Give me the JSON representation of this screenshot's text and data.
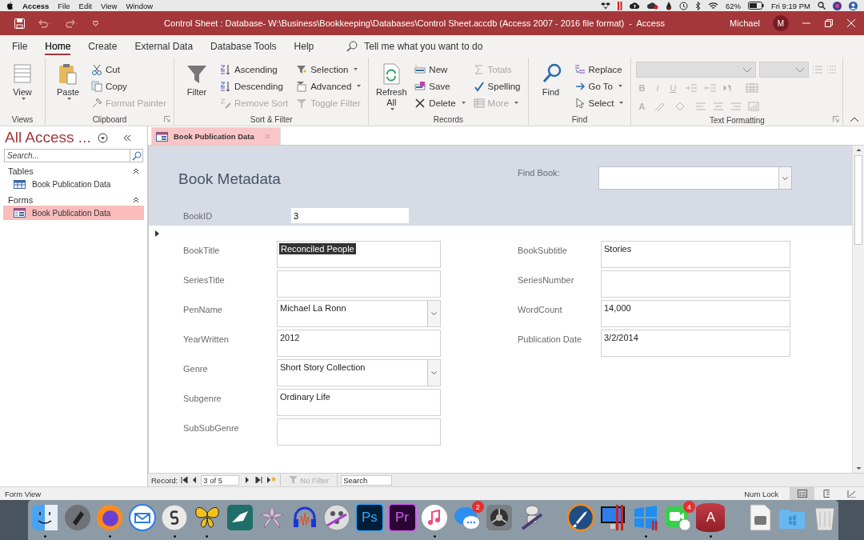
{
  "menu_bar": {
    "app_name": "Access",
    "menus": [
      "File",
      "Edit",
      "View",
      "Window"
    ],
    "battery": "62%",
    "clock": "Fri 9:19 PM"
  },
  "title_bar": {
    "title": "Control Sheet : Database- W:\\Business\\Bookkeeping\\Databases\\Control Sheet.accdb (Access 2007 - 2016 file format)  -  Access",
    "user": "Michael",
    "avatar_initial": "M"
  },
  "ribbon": {
    "tabs": [
      {
        "label": "File",
        "selected": false
      },
      {
        "label": "Home",
        "selected": true
      },
      {
        "label": "Create",
        "selected": false
      },
      {
        "label": "External Data",
        "selected": false
      },
      {
        "label": "Database Tools",
        "selected": false
      },
      {
        "label": "Help",
        "selected": false
      }
    ],
    "tell_me": "Tell me what you want to do",
    "groups": [
      {
        "label": "Views",
        "kind": "commands",
        "launcher": false,
        "commands": [
          {
            "label": "View",
            "kind": "large",
            "disabled": false,
            "dropdown": true
          }
        ]
      },
      {
        "label": "Clipboard",
        "kind": "commands",
        "launcher": true,
        "commands": [
          {
            "label": "Paste",
            "kind": "large",
            "disabled": false,
            "dropdown": true
          },
          {
            "label": "Cut",
            "kind": "small",
            "disabled": false,
            "dropdown": false
          },
          {
            "label": "Copy",
            "kind": "small",
            "disabled": false,
            "dropdown": false
          },
          {
            "label": "Format Painter",
            "kind": "small",
            "disabled": true,
            "dropdown": false
          }
        ]
      },
      {
        "label": "Sort & Filter",
        "kind": "commands",
        "launcher": false,
        "commands": [
          {
            "label": "Filter",
            "kind": "large",
            "disabled": false,
            "dropdown": false
          },
          {
            "label": "Ascending",
            "kind": "small",
            "disabled": false,
            "dropdown": false
          },
          {
            "label": "Descending",
            "kind": "small",
            "disabled": false,
            "dropdown": false
          },
          {
            "label": "Remove Sort",
            "kind": "small",
            "disabled": true,
            "dropdown": false
          },
          {
            "label": "Selection",
            "kind": "small",
            "disabled": false,
            "dropdown": true
          },
          {
            "label": "Advanced",
            "kind": "small",
            "disabled": false,
            "dropdown": true
          },
          {
            "label": "Toggle Filter",
            "kind": "small",
            "disabled": true,
            "dropdown": false
          }
        ]
      },
      {
        "label": "Records",
        "kind": "commands",
        "launcher": false,
        "commands": [
          {
            "label": "Refresh All",
            "kind": "large",
            "disabled": false,
            "dropdown": true
          },
          {
            "label": "New",
            "kind": "small",
            "disabled": false,
            "dropdown": false
          },
          {
            "label": "Save",
            "kind": "small",
            "disabled": false,
            "dropdown": false
          },
          {
            "label": "Delete",
            "kind": "small",
            "disabled": false,
            "dropdown": true
          },
          {
            "label": "Totals",
            "kind": "small",
            "disabled": true,
            "dropdown": false
          },
          {
            "label": "Spelling",
            "kind": "small",
            "disabled": false,
            "dropdown": false
          },
          {
            "label": "More",
            "kind": "small",
            "disabled": true,
            "dropdown": true
          }
        ]
      },
      {
        "label": "Find",
        "kind": "commands",
        "launcher": false,
        "commands": [
          {
            "label": "Find",
            "kind": "large",
            "disabled": false,
            "dropdown": false
          },
          {
            "label": "Replace",
            "kind": "small",
            "disabled": false,
            "dropdown": false
          },
          {
            "label": "Go To",
            "kind": "small",
            "disabled": false,
            "dropdown": true
          },
          {
            "label": "Select",
            "kind": "small",
            "disabled": false,
            "dropdown": true
          }
        ]
      },
      {
        "label": "Text Formatting",
        "kind": "formatting",
        "launcher": true,
        "disabled": true,
        "glyphs": [
          "B",
          "I",
          "U",
          "A"
        ]
      }
    ]
  },
  "navigation": {
    "title": "All Access ...",
    "search_placeholder": "Search...",
    "groups": [
      {
        "label": "Tables",
        "expanded": true,
        "items": [
          {
            "label": "Book Publication Data",
            "selected": false
          }
        ]
      },
      {
        "label": "Forms",
        "expanded": true,
        "items": [
          {
            "label": "Book Publication Data",
            "selected": true
          }
        ]
      }
    ]
  },
  "document_tabs": [
    {
      "label": "Book Publication Data",
      "selected": true
    }
  ],
  "form": {
    "title": "Book Metadata",
    "find_label": "Find Book:",
    "id_field": {
      "label": "BookID",
      "value": "3"
    },
    "left_fields": [
      {
        "label": "BookTitle",
        "value": "Reconciled People",
        "kind": "text",
        "text_selected": true
      },
      {
        "label": "SeriesTitle",
        "kind": "text",
        "text_selected": false
      },
      {
        "label": "PenName",
        "value": "Michael La Ronn",
        "kind": "combo",
        "text_selected": false
      },
      {
        "label": "YearWritten",
        "value": "2012",
        "kind": "text",
        "text_selected": false
      },
      {
        "label": "Genre",
        "value": "Short Story Collection",
        "kind": "combo",
        "text_selected": false
      },
      {
        "label": "Subgenre",
        "value": "Ordinary Life",
        "kind": "text",
        "text_selected": false
      },
      {
        "label": "SubSubGenre",
        "kind": "text",
        "text_selected": false
      }
    ],
    "right_fields": [
      {
        "label": "BookSubtitle",
        "value": "Stories",
        "kind": "text",
        "text_selected": false
      },
      {
        "label": "SeriesNumber",
        "kind": "text",
        "text_selected": false
      },
      {
        "label": "WordCount",
        "value": "14,000",
        "kind": "text",
        "text_selected": false
      },
      {
        "label": "Publication Date",
        "value": "3/2/2014",
        "kind": "text",
        "text_selected": false
      }
    ]
  },
  "record_nav": {
    "label": "Record:",
    "position": "3 of 5",
    "filter": "No Filter",
    "search_placeholder": "Search"
  },
  "status_bar": {
    "mode": "Form View",
    "indicator": "Num Lock",
    "views": [
      {
        "selected": true
      },
      {
        "selected": false
      },
      {
        "selected": false
      }
    ]
  },
  "dock": {
    "items": [
      {
        "running": true
      },
      {
        "running": false
      },
      {
        "running": true
      },
      {
        "running": false
      },
      {
        "running": true
      },
      {
        "running": true
      },
      {
        "running": false
      },
      {
        "running": false
      },
      {
        "running": false
      },
      {
        "running": false
      },
      {
        "running": false,
        "glyph": "Ps"
      },
      {
        "running": false,
        "glyph": "Pr"
      },
      {
        "running": true
      },
      {
        "running": false,
        "badge": "2"
      },
      {
        "running": false
      },
      {
        "running": false
      },
      {
        "running": false
      },
      {
        "running": false
      },
      {
        "running": true
      },
      {
        "running": false,
        "badge": "4"
      },
      {
        "running": true,
        "glyph": "A"
      },
      {
        "running": false
      },
      {
        "running": false
      },
      {
        "running": false
      }
    ]
  }
}
